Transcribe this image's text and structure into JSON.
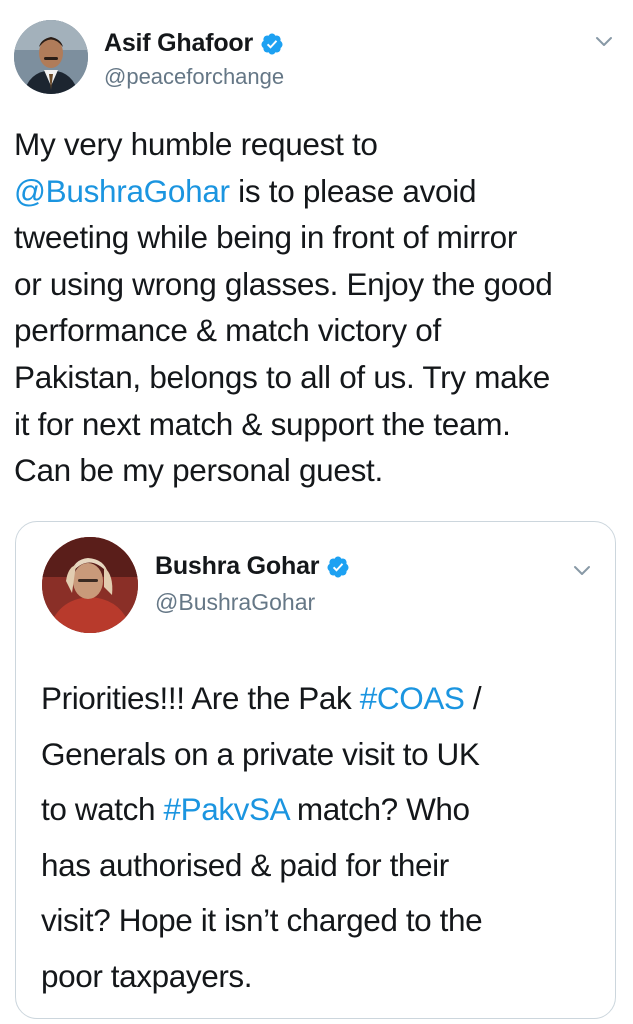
{
  "tweet": {
    "author_name": "Asif Ghafoor",
    "author_handle": "@peaceforchange",
    "icons": {
      "verified": "verified-badge-icon",
      "menu": "chevron-down-icon",
      "avatar": "profile-photo"
    },
    "text_lines": [
      "My very humble request to",
      "@BushraGohar",
      " is to please avoid",
      "tweeting while being in front of mirror",
      "or using wrong glasses. Enjoy the good",
      "performance & match victory of",
      "Pakistan, belongs to all of us. Try make",
      "it for next match & support the team.",
      "Can be my personal guest."
    ]
  },
  "quoted_tweet": {
    "author_name": "Bushra Gohar",
    "author_handle": "@BushraGohar",
    "text": {
      "l1a": "Priorities!!! Are the Pak ",
      "l1_tag": "#COAS",
      "l1b": " /",
      "l2": "Generals on a private visit to UK",
      "l3a": "to watch ",
      "l3_tag": "#PakvSA",
      "l3b": " match? Who",
      "l4": "has authorised & paid for their",
      "l5": "visit? Hope it isn’t charged to the",
      "l6": "poor taxpayers."
    }
  },
  "colors": {
    "link": "#1b95e0",
    "verified": "#1da1f2",
    "secondary_text": "#657786",
    "border": "#ccd6dd"
  }
}
